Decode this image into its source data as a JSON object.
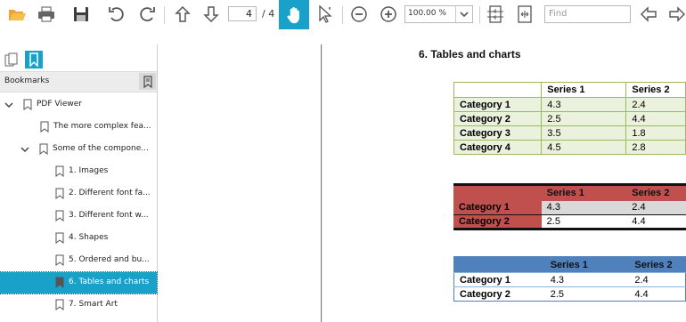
{
  "toolbar": {
    "icons": [
      "open-folder-icon",
      "print-icon",
      "save-icon",
      "rotate-counterclockwise-icon",
      "rotate-clockwise-icon",
      "arrow-up-icon",
      "arrow-down-icon",
      "hand-tool-icon",
      "select-tool-icon",
      "zoom-out-icon",
      "zoom-in-icon",
      "fit-page-icon",
      "fit-width-icon",
      "find-previous-icon",
      "find-next-icon"
    ],
    "page_current": "4",
    "page_total": "/ 4",
    "zoom": "100.00 %",
    "find_placeholder": "Find",
    "accent_color": "#1aa1c9"
  },
  "sidebar": {
    "header": "Bookmarks",
    "bookmarks": [
      {
        "label": "PDF Viewer"
      },
      {
        "label": "The more complex fea..."
      },
      {
        "label": "Some of the compone..."
      },
      {
        "label": "1. Images"
      },
      {
        "label": "2. Different font fa..."
      },
      {
        "label": "3. Different font w..."
      },
      {
        "label": "4. Shapes"
      },
      {
        "label": "5. Ordered and bu..."
      },
      {
        "label": "6. Tables and charts"
      },
      {
        "label": "7. Smart Art"
      }
    ]
  },
  "document": {
    "heading": "6.   Tables and charts",
    "tables": [
      {
        "header": [
          "",
          "Series 1",
          "Series 2"
        ],
        "rows": [
          [
            "Category 1",
            "4.3",
            "2.4"
          ],
          [
            "Category 2",
            "2.5",
            "4.4"
          ],
          [
            "Category 3",
            "3.5",
            "1.8"
          ],
          [
            "Category 4",
            "4.5",
            "2.8"
          ]
        ]
      },
      {
        "header": [
          "",
          "Series 1",
          "Series 2"
        ],
        "rows": [
          [
            "Category 1",
            "4.3",
            "2.4"
          ],
          [
            "Category 2",
            "2.5",
            "4.4"
          ]
        ]
      },
      {
        "header": [
          "",
          "Series 1",
          "Series 2"
        ],
        "rows": [
          [
            "Category 1",
            "4.3",
            "2.4"
          ],
          [
            "Category 2",
            "2.5",
            "4.4"
          ]
        ]
      }
    ]
  }
}
